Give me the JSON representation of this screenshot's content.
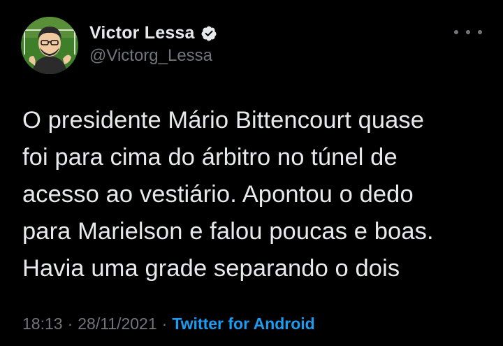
{
  "tweet": {
    "author": {
      "display_name": "Victor Lessa",
      "handle": "@Victorg_Lessa",
      "verified": true
    },
    "text": "O presidente Mário Bittencourt quase\nfoi para cima do árbitro no túnel de\nacesso ao vestiário. Apontou o dedo\npara Marielson e falou poucas e boas.\nHavia uma grade separando o dois",
    "time": "18:13",
    "separator": "·",
    "date": "28/11/2021",
    "source": "Twitter for Android"
  },
  "icons": {
    "verified": "verified-badge-icon",
    "more": "more-options-icon"
  },
  "colors": {
    "background": "#000000",
    "primary_text": "#e7e9ea",
    "secondary_text": "#71767b",
    "link": "#1d9bf0"
  }
}
